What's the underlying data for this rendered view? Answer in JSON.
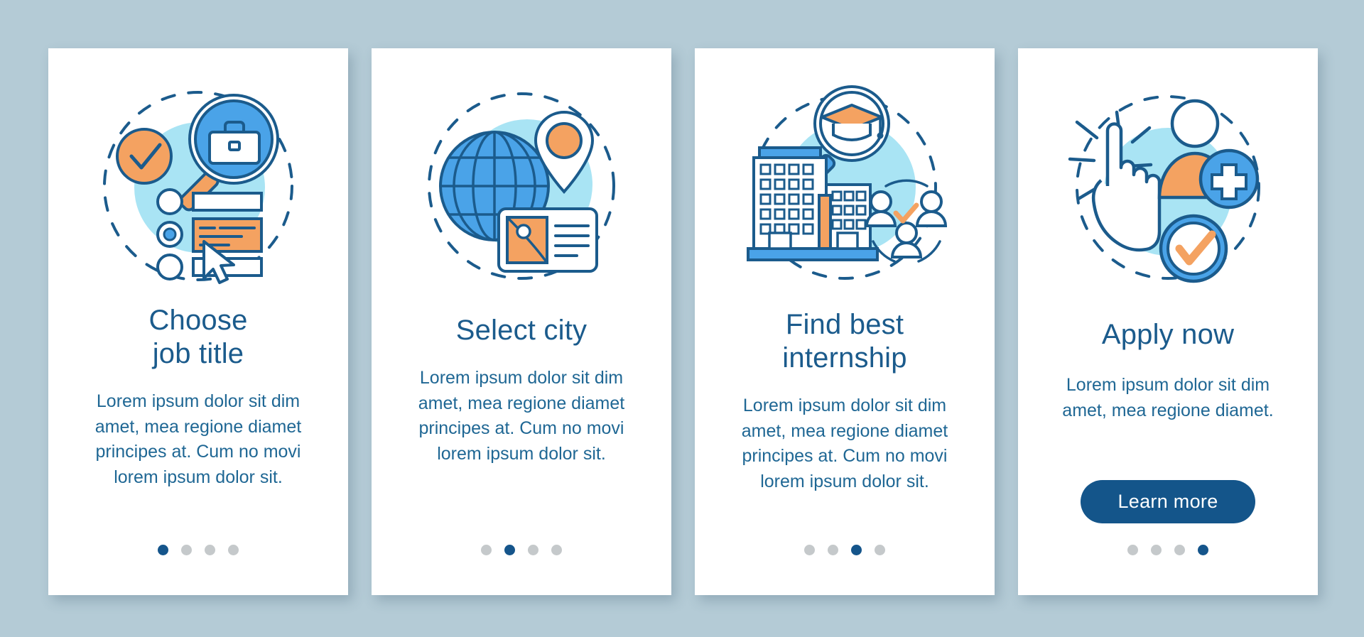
{
  "theme": {
    "page_background": "#b4cbd6",
    "card_background": "#ffffff",
    "title_color": "#1b5b8c",
    "body_color": "#1f6794",
    "accent_orange": "#f4a261",
    "accent_blue": "#4aa3e8",
    "accent_light_cyan": "#a9e4f4",
    "accent_dark_navy": "#14558a",
    "dot_inactive": "#c5c9cb",
    "dot_active": "#15558b"
  },
  "cards": [
    {
      "illustration": "job-search-illustration",
      "title": "Choose\njob title",
      "body": "Lorem ipsum dolor sit dim amet, mea regione diamet principes at. Cum no movi lorem ipsum dolor sit.",
      "dots": {
        "count": 4,
        "active_index": 0
      }
    },
    {
      "illustration": "globe-location-illustration",
      "title": "Select city",
      "body": "Lorem ipsum dolor sit dim amet, mea regione diamet principes at. Cum no movi lorem ipsum dolor sit.",
      "dots": {
        "count": 4,
        "active_index": 1
      }
    },
    {
      "illustration": "campus-graduation-illustration",
      "title": "Find best\ninternship",
      "body": "Lorem ipsum dolor sit dim amet, mea regione diamet principes at. Cum no movi lorem ipsum dolor sit.",
      "dots": {
        "count": 4,
        "active_index": 2
      }
    },
    {
      "illustration": "apply-click-illustration",
      "title": "Apply now",
      "body": "Lorem ipsum dolor sit dim amet, mea regione diamet.",
      "button_label": "Learn more",
      "dots": {
        "count": 4,
        "active_index": 3
      }
    }
  ]
}
